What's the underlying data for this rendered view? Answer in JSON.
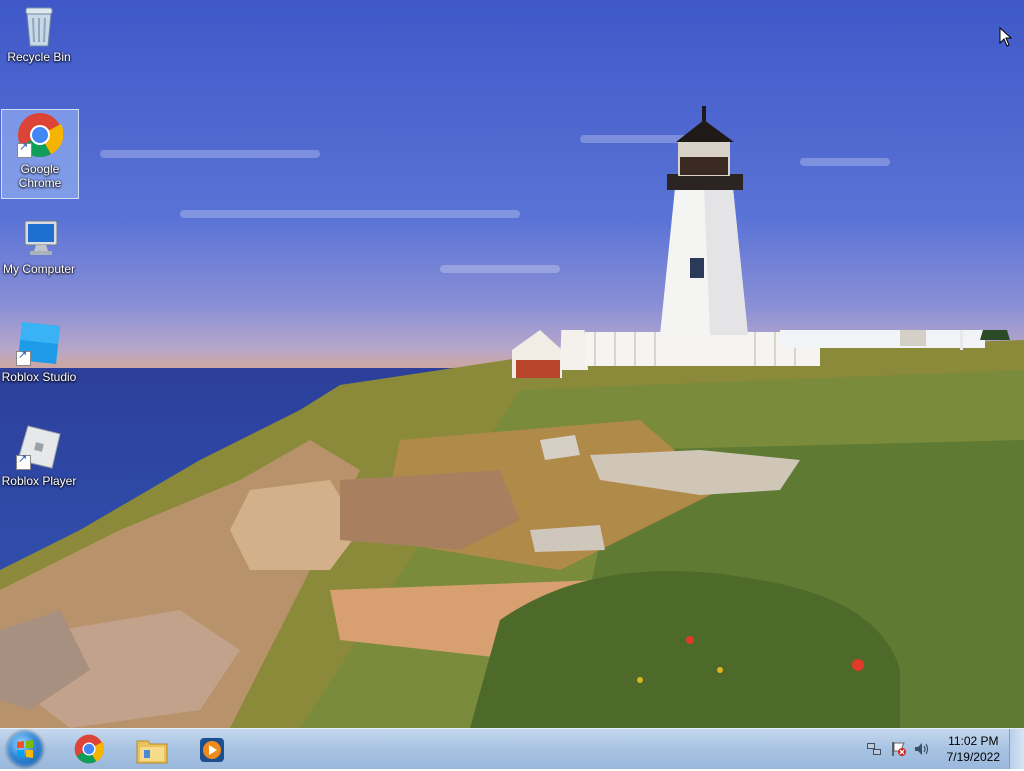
{
  "desktop": {
    "icons": [
      {
        "label": "Recycle Bin",
        "icon": "recycle-bin-icon"
      },
      {
        "label": "Google Chrome",
        "icon": "chrome-icon",
        "selected": true
      },
      {
        "label": "My Computer",
        "icon": "computer-icon"
      },
      {
        "label": "Roblox Studio",
        "icon": "roblox-studio-icon"
      },
      {
        "label": "Roblox Player",
        "icon": "roblox-player-icon"
      }
    ],
    "wallpaper": "lighthouse-landscape"
  },
  "taskbar": {
    "start_icon": "windows-start-orb",
    "pinned": [
      {
        "name": "Google Chrome",
        "icon": "chrome-icon"
      },
      {
        "name": "Windows Explorer",
        "icon": "folder-icon"
      },
      {
        "name": "Windows Media Player",
        "icon": "media-player-icon"
      }
    ],
    "tray": [
      {
        "icon": "network-icon"
      },
      {
        "icon": "action-center-flag-icon"
      },
      {
        "icon": "volume-icon"
      }
    ],
    "clock": {
      "time": "11:02 PM",
      "date": "7/19/2022"
    }
  }
}
